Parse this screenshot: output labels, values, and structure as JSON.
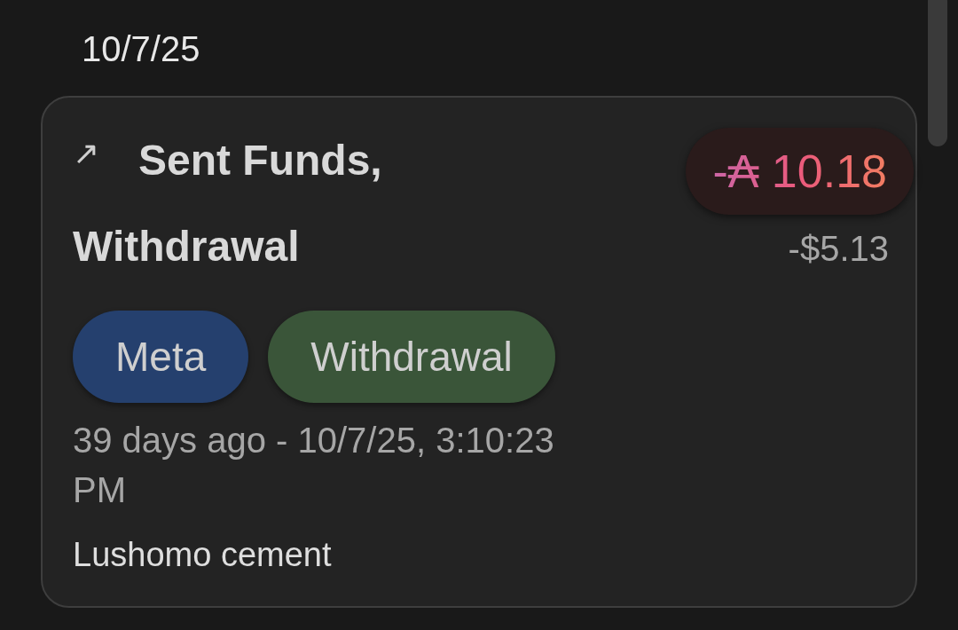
{
  "date_header": "10/7/25",
  "transaction": {
    "direction_icon": "↗",
    "title_lines": [
      "Sent Funds,",
      "Withdrawal"
    ],
    "amount": "-₳ 10.18",
    "fiat_amount": "-$5.13",
    "tags": [
      {
        "label": "Meta",
        "color": "#25406e"
      },
      {
        "label": "Withdrawal",
        "color": "#3a5539"
      }
    ],
    "time": "39 days ago - 10/7/25, 3:10:23 PM",
    "note": "Lushomo cement"
  }
}
